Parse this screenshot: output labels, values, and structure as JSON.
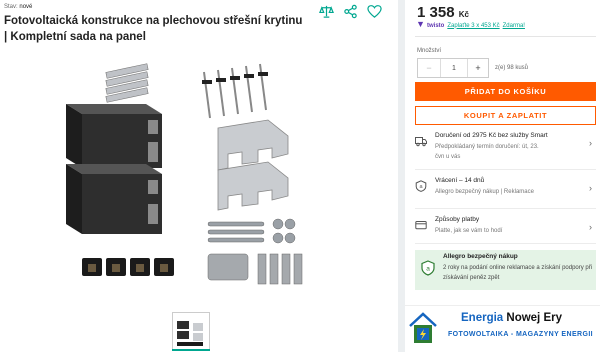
{
  "product": {
    "condition_label": "Stav:",
    "condition_value": "nové",
    "title": "Fotovoltaická konstrukce na plechovou střešní krytinu | Kompletní sada na panel"
  },
  "actions": {
    "compare_icon": "scales-icon",
    "share_icon": "share-icon",
    "favorite_icon": "heart-icon"
  },
  "pricing": {
    "price": "1 358",
    "currency": "Kč",
    "twisto_brand": "twisto",
    "twisto_link": "Zaplaťte 3 x 453 Kč",
    "twisto_free": "Zdarma!"
  },
  "quantity": {
    "label": "Množství",
    "value": "1",
    "minus": "−",
    "plus": "+",
    "stock": "z(e) 98 kusů"
  },
  "buttons": {
    "add_to_cart": "PŘIDAT DO KOŠÍKU",
    "buy_now": "KOUPIT A ZAPLATIT"
  },
  "info_rows": [
    {
      "icon": "truck-icon",
      "title": "Doručení od 2975 Kč bez služby Smart",
      "subtitle_1": "Předpokládaný termín doručení: út, 23.",
      "subtitle_2": "čvn u vás"
    },
    {
      "icon": "return-icon",
      "title": "Vrácení – 14 dnů",
      "subtitle_1": "Allegro bezpečný nákup | Reklamace"
    },
    {
      "icon": "card-icon",
      "title": "Způsoby platby",
      "subtitle_1": "Platte, jak se vám to hodí"
    }
  ],
  "safe_purchase": {
    "title": "Allegro bezpečný nákup",
    "text": "2 roky na podání online reklamace a získání podpory při získávání peněz zpět"
  },
  "watermark": {
    "line1_a": "Energia",
    "line1_b": "Nowej Ery",
    "line2": "FOTOWOLTAIKA - MAGAZYNY ENERGII"
  },
  "colors": {
    "accent": "#ff5a00",
    "teal": "#00a790",
    "safe_bg": "#e4f3e6",
    "brand_blue": "#1565c0"
  }
}
